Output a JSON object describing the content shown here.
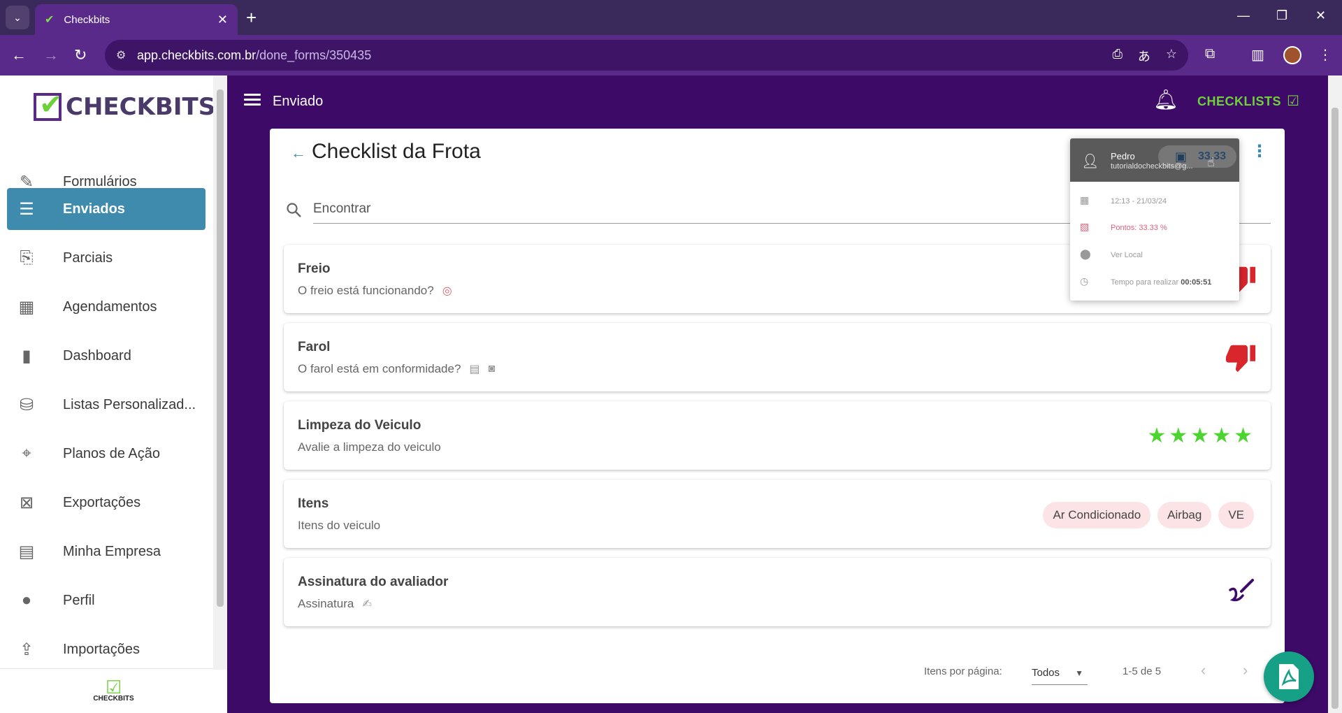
{
  "browser": {
    "tab_title": "Checkbits",
    "url_host": "app.checkbits.com.br",
    "url_path": "/done_forms/350435"
  },
  "brand": {
    "logo_text": "CHECKBITS",
    "footer_logo_text": "CHECKBITS",
    "accent_green": "#6fd13a",
    "primary_purple": "#3d0a68",
    "active_blue": "#3f8bae"
  },
  "sidebar": {
    "items": [
      {
        "label": "Formulários",
        "icon": "form-edit-icon"
      },
      {
        "label": "Enviados",
        "icon": "sent-list-icon",
        "active": true
      },
      {
        "label": "Parciais",
        "icon": "partial-docs-icon"
      },
      {
        "label": "Agendamentos",
        "icon": "calendar-check-icon"
      },
      {
        "label": "Dashboard",
        "icon": "bar-chart-icon"
      },
      {
        "label": "Listas Personalizad...",
        "icon": "database-icon"
      },
      {
        "label": "Planos de Ação",
        "icon": "crosshair-icon"
      },
      {
        "label": "Exportações",
        "icon": "excel-file-icon"
      },
      {
        "label": "Minha Empresa",
        "icon": "building-icon"
      },
      {
        "label": "Perfil",
        "icon": "person-icon"
      },
      {
        "label": "Importações",
        "icon": "import-file-icon"
      }
    ]
  },
  "header": {
    "title": "Enviado",
    "checklists_label": "CHECKLISTS"
  },
  "form": {
    "title": "Checklist da Frota",
    "search_placeholder": "Encontrar",
    "items": [
      {
        "title": "Freio",
        "subtitle": "O freio está funcionando?",
        "answer": "thumbs-down"
      },
      {
        "title": "Farol",
        "subtitle": "O farol está em conformidade?",
        "answer": "thumbs-down"
      },
      {
        "title": "Limpeza do Veiculo",
        "subtitle": "Avalie a limpeza do veiculo",
        "answer": "stars",
        "rating": 5,
        "rating_max": 5
      },
      {
        "title": "Itens",
        "subtitle": "Itens do veiculo",
        "answer": "chips",
        "chips": [
          "Ar Condicionado",
          "Airbag",
          "VE"
        ]
      },
      {
        "title": "Assinatura do avaliador",
        "subtitle": "Assinatura",
        "answer": "signature"
      }
    ],
    "pagination": {
      "per_page_label": "Itens por página:",
      "per_page_value": "Todos",
      "range": "1-5 de 5"
    }
  },
  "popover": {
    "user_name": "Pedro",
    "user_email": "tutorialdocheckbits@g...",
    "score_badge": "33.33",
    "datetime": "12:13 - 21/03/24",
    "points_label": "Pontos:",
    "points_value": "33.33 %",
    "location_label": "Ver Local",
    "time_label": "Tempo para realizar",
    "time_value": "00:05:51"
  }
}
